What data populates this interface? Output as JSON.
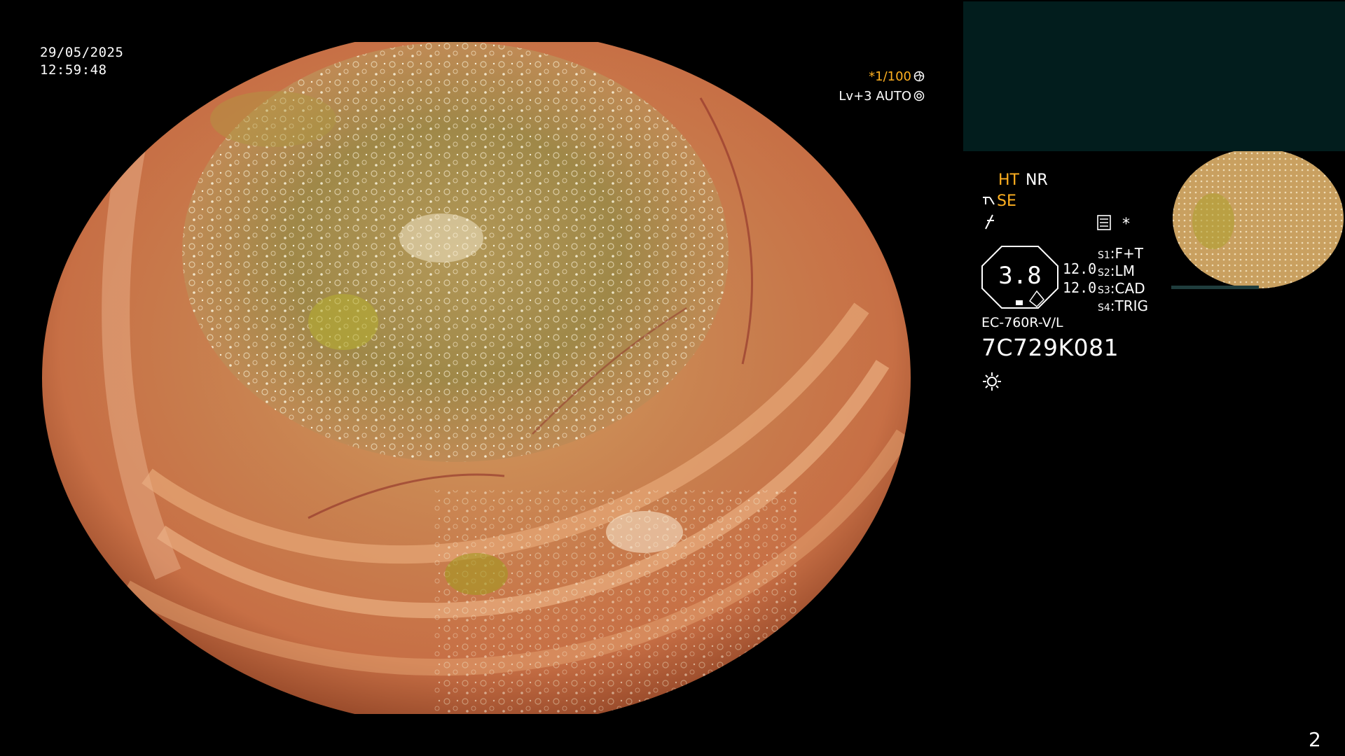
{
  "overlay": {
    "date": "29/05/2025",
    "time": "12:59:48",
    "shutter": "*1/100",
    "level": "Lv+3 AUTO"
  },
  "info_panel": {
    "ht": "HT",
    "nr": "NR",
    "se": "SE",
    "settings_star": "*",
    "zoom_value": "3.8",
    "value_1": "12.0",
    "value_2": "12.0",
    "switches": [
      {
        "key": "S1",
        "value": "F+T"
      },
      {
        "key": "S2",
        "value": "LM"
      },
      {
        "key": "S3",
        "value": "CAD"
      },
      {
        "key": "S4",
        "value": "TRIG"
      }
    ],
    "model": "EC-760R-V/L",
    "serial": "7C729K081"
  },
  "page_number": "2",
  "colors": {
    "accent_orange": "#ffb020",
    "panel_teal": "#021d1d",
    "background": "#000000"
  },
  "icons": [
    "shutter-icon",
    "auto-exposure-icon",
    "structure-enhance-icon",
    "f-mode-icon",
    "settings-icon",
    "lamp-icon"
  ]
}
